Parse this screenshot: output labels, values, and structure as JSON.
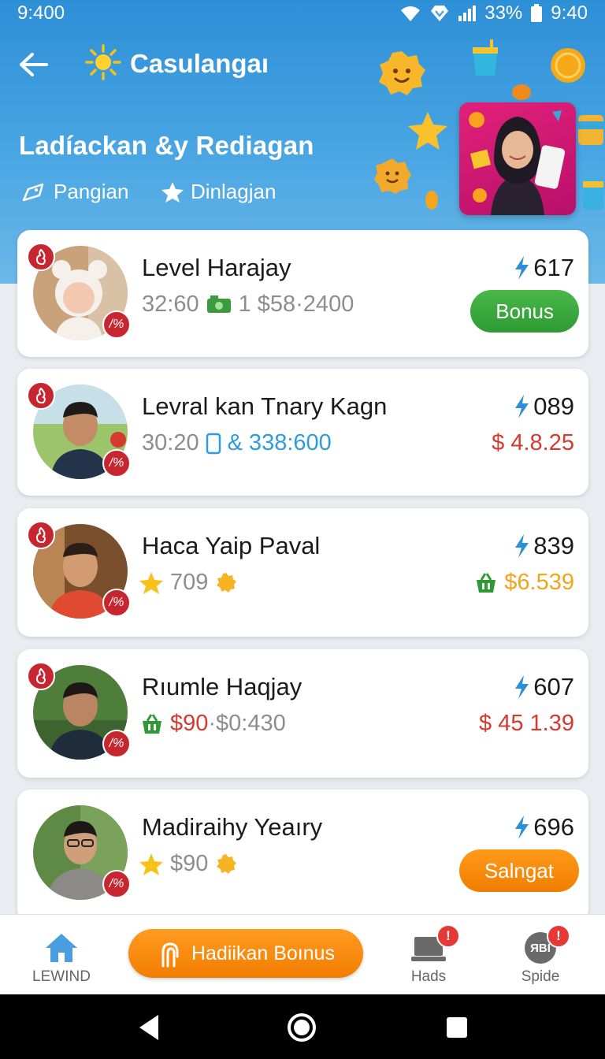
{
  "status_bar": {
    "time": "9:400",
    "battery": "33%",
    "clock": "9:40"
  },
  "header": {
    "app_title": "Casulangaı",
    "page_title": "Ladíackan &y Rediagan",
    "chips": [
      {
        "label": "Pangian",
        "icon": "tag-icon"
      },
      {
        "label": "Dinlagjan",
        "icon": "star-icon"
      }
    ]
  },
  "list": [
    {
      "name": "Level Harajay",
      "sub_time": "32:60",
      "sub_icon": "cash-icon",
      "sub_text": "1 $58·2400",
      "score": "617",
      "action": {
        "type": "button",
        "label": "Bonus",
        "color": "#2e9a33"
      }
    },
    {
      "name": "Levral kan Tnary Kagn",
      "sub_time": "30:20",
      "sub_icon": "phone-icon",
      "sub_text": "& 338:600",
      "score": "089",
      "action": {
        "type": "amount",
        "label": "$ 4.8.25",
        "color": "#d63a2e"
      }
    },
    {
      "name": "Haca Yaip Paval",
      "sub_time": "709",
      "sub_icon": "star-icon",
      "sub_text": "",
      "score": "839",
      "action": {
        "type": "amount",
        "label": "$6.539",
        "color": "#f2a51b"
      }
    },
    {
      "name": "Rıumle Haqjay",
      "sub_time": "$90",
      "sub_icon": "basket-icon",
      "sub_text": "·$0:430",
      "score": "607",
      "action": {
        "type": "amount",
        "label": "$ 45 1.39",
        "color": "#d63a2e"
      }
    },
    {
      "name": "Madiraihy Yeaıry",
      "sub_time": "$90",
      "sub_icon": "star-icon",
      "sub_text": "",
      "score": "696",
      "action": {
        "type": "button",
        "label": "Salngat",
        "color": "#f07e00"
      }
    }
  ],
  "badge_mark": "/%",
  "bottom_nav": {
    "home_label": "LEWIND",
    "center_label": "Hadiikan Boınus",
    "hads_label": "Hads",
    "spide_label": "Spide",
    "hads_badge": "!",
    "spide_badge": "!",
    "spide_icon_text": "ЯBI"
  }
}
